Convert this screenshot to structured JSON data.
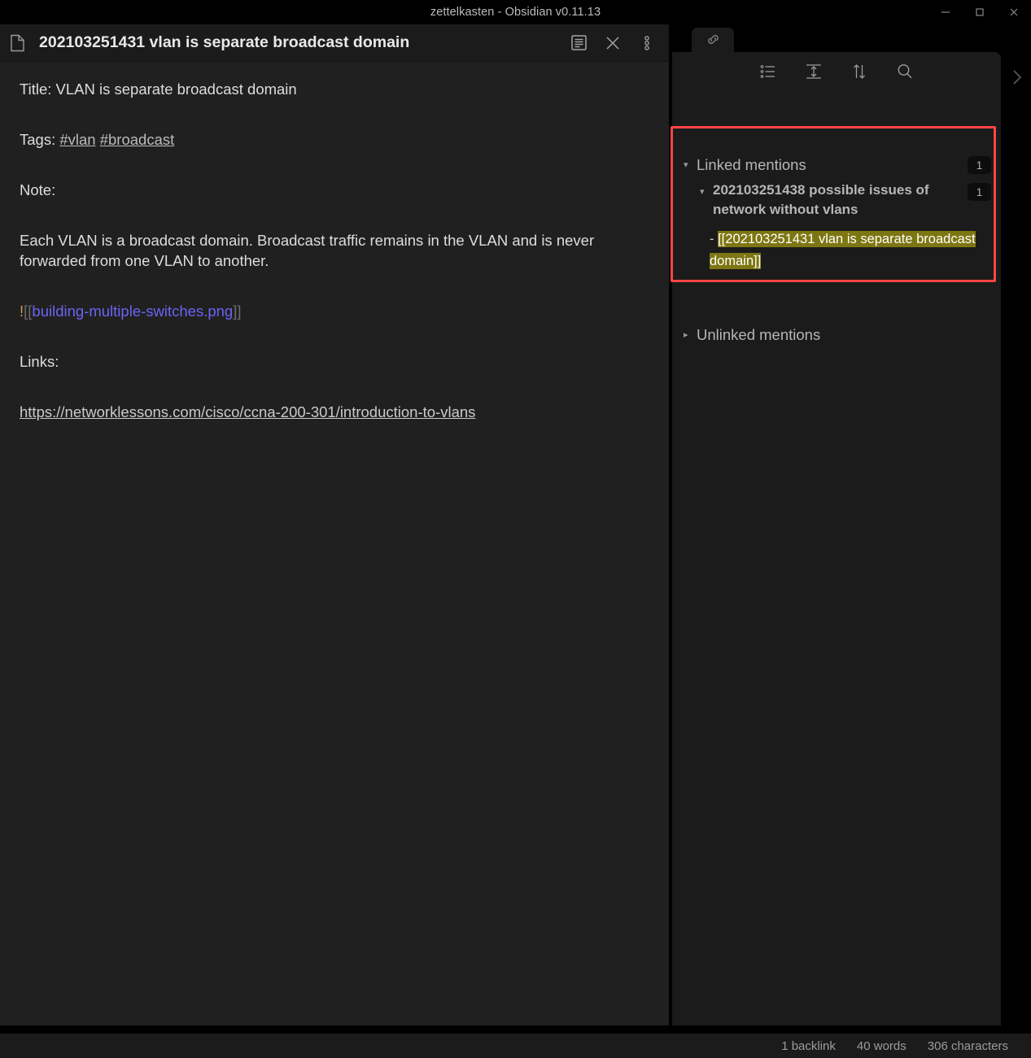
{
  "window": {
    "title": "zettelkasten - Obsidian v0.11.13",
    "controls": [
      {
        "name": "minimize",
        "glyph": "minimize-icon"
      },
      {
        "name": "maximize",
        "glyph": "maximize-icon"
      },
      {
        "name": "close",
        "glyph": "close-icon"
      }
    ]
  },
  "editor": {
    "file_icon": "document-icon",
    "title": "202103251431 vlan is separate broadcast domain",
    "header_actions": [
      {
        "name": "reading-view-icon",
        "label": "Change view"
      },
      {
        "name": "close-icon",
        "label": "Close"
      },
      {
        "name": "more-options-icon",
        "label": "More options"
      }
    ],
    "lines": {
      "title_line": "Title: VLAN is separate broadcast domain",
      "tags_label": "Tags: ",
      "tag_1": "#vlan",
      "tag_2": "#broadcast",
      "note_label": "Note:",
      "note_body": "Each VLAN is a broadcast domain. Broadcast traffic remains in the VLAN and is never forwarded from one VLAN to another.",
      "embed_bang": "!",
      "embed_open": "[[",
      "embed_name": "building-multiple-switches.png",
      "embed_close": "]]",
      "links_label": "Links:",
      "url": "https://networklessons.com/cisco/ccna-200-301/introduction-to-vlans"
    }
  },
  "sidebar": {
    "tab": {
      "name": "backlinks-tab",
      "icon": "link-icon"
    },
    "toolbar": [
      {
        "name": "collapse-results-icon",
        "label": "Collapse results"
      },
      {
        "name": "show-more-context-icon",
        "label": "Show more context"
      },
      {
        "name": "change-sort-order-icon",
        "label": "Change sort order"
      },
      {
        "name": "search-icon",
        "label": "Search"
      }
    ],
    "linked": {
      "caret": "▾",
      "title": "Linked mentions",
      "count": "1",
      "file": {
        "caret": "▾",
        "title": "202103251438 possible issues of network without vlans",
        "count": "1",
        "context_dash": "-",
        "context_highlight": "[[202103251431 vlan is separate broadcast domain]]"
      }
    },
    "unlinked": {
      "caret": "▸",
      "title": "Unlinked mentions"
    },
    "expand_arrow": "chevron-right-icon",
    "highlight_box_color": "#ff4545"
  },
  "statusbar": {
    "backlinks": "1 backlink",
    "words": "40 words",
    "characters": "306 characters"
  },
  "colors": {
    "accent_link": "#6c63f5",
    "highlight_bg": "#7d7612",
    "panel_bg": "#1b1b1b",
    "editor_bg": "#202020"
  }
}
